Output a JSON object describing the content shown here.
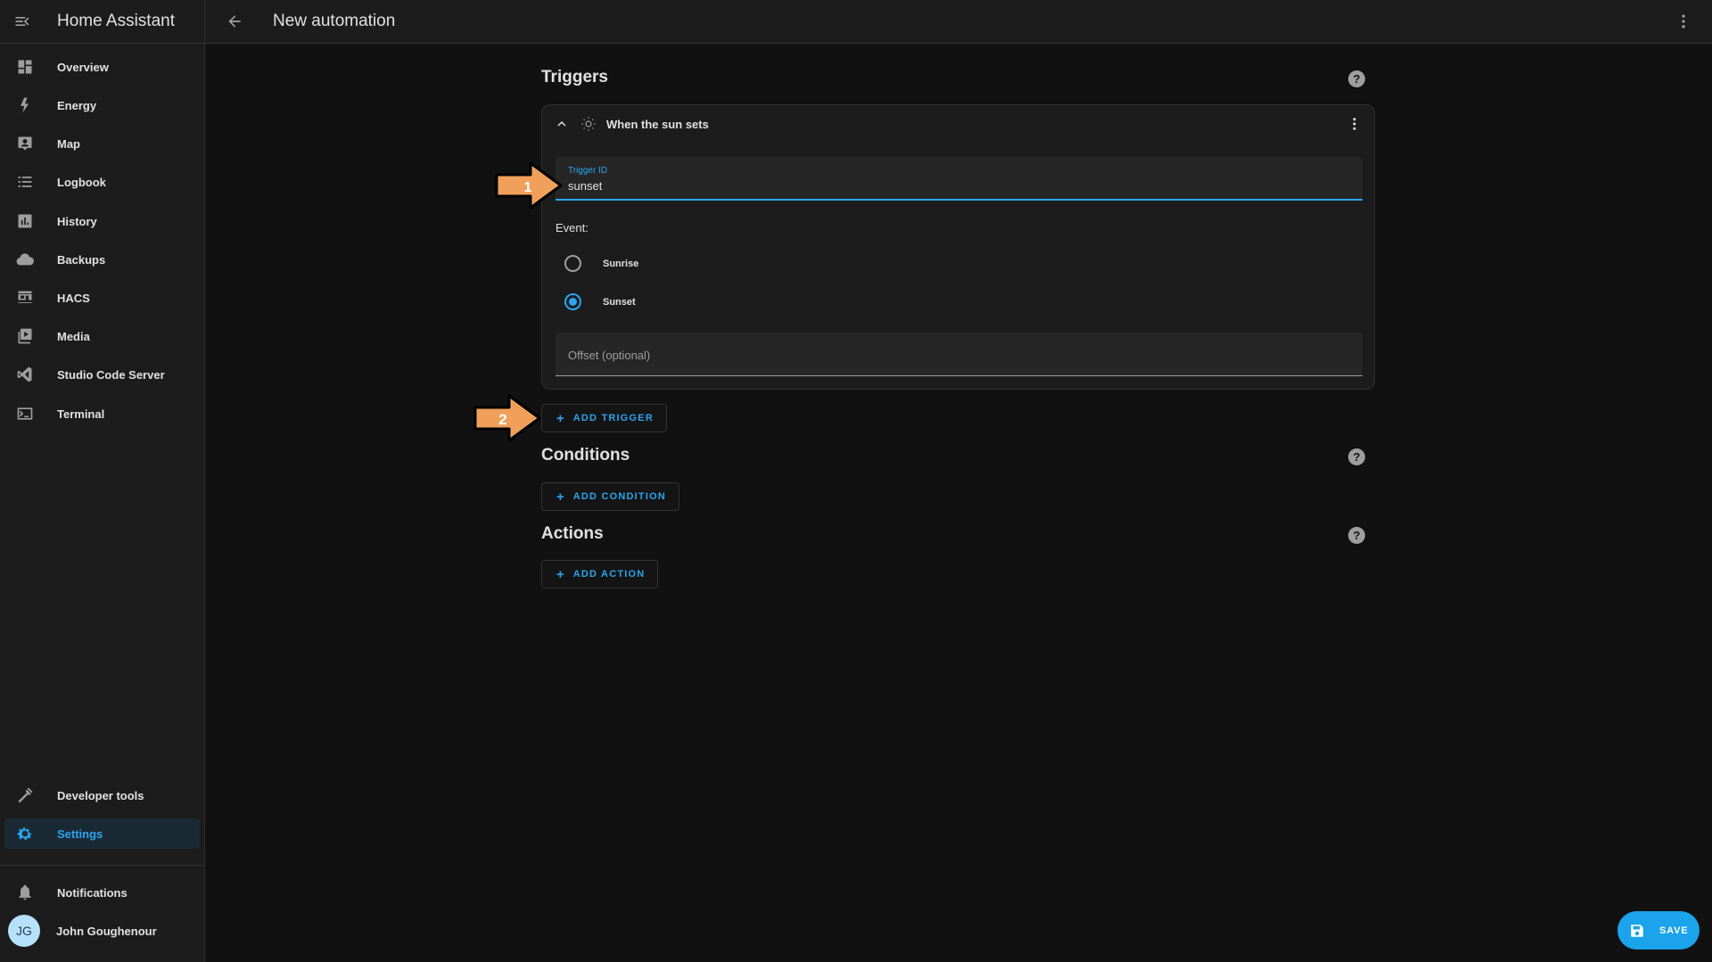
{
  "sidebar": {
    "title": "Home Assistant",
    "items": [
      {
        "label": "Overview",
        "icon": "dashboard-icon"
      },
      {
        "label": "Energy",
        "icon": "lightning-icon"
      },
      {
        "label": "Map",
        "icon": "map-person-icon"
      },
      {
        "label": "Logbook",
        "icon": "list-icon"
      },
      {
        "label": "History",
        "icon": "chart-box-icon"
      },
      {
        "label": "Backups",
        "icon": "cloud-icon"
      },
      {
        "label": "HACS",
        "icon": "hacs-store-icon"
      },
      {
        "label": "Media",
        "icon": "media-play-icon"
      },
      {
        "label": "Studio Code Server",
        "icon": "vscode-icon"
      },
      {
        "label": "Terminal",
        "icon": "terminal-icon"
      }
    ],
    "bottom_items": [
      {
        "label": "Developer tools",
        "icon": "hammer-icon"
      },
      {
        "label": "Settings",
        "icon": "gear-icon",
        "active": true
      }
    ],
    "notifications_label": "Notifications",
    "user": {
      "name": "John Goughenour",
      "initials": "JG"
    }
  },
  "header": {
    "title": "New automation"
  },
  "triggers": {
    "title": "Triggers",
    "card": {
      "title": "When the sun sets",
      "trigger_id_label": "Trigger ID",
      "trigger_id_value": "sunset",
      "event_label": "Event:",
      "options": [
        {
          "label": "Sunrise",
          "checked": false
        },
        {
          "label": "Sunset",
          "checked": true
        }
      ],
      "offset_placeholder": "Offset (optional)"
    },
    "add_label": "ADD TRIGGER"
  },
  "conditions": {
    "title": "Conditions",
    "add_label": "ADD CONDITION"
  },
  "actions": {
    "title": "Actions",
    "add_label": "ADD ACTION"
  },
  "annotations": {
    "arrow1_label": "1",
    "arrow2_label": "2",
    "arrow_color": "#f0a05a"
  },
  "save_label": "SAVE",
  "help_glyph": "?",
  "colors": {
    "accent": "#2aa5ee",
    "fab": "#1ba3ec",
    "background": "#111111",
    "surface": "#1c1c1c"
  }
}
